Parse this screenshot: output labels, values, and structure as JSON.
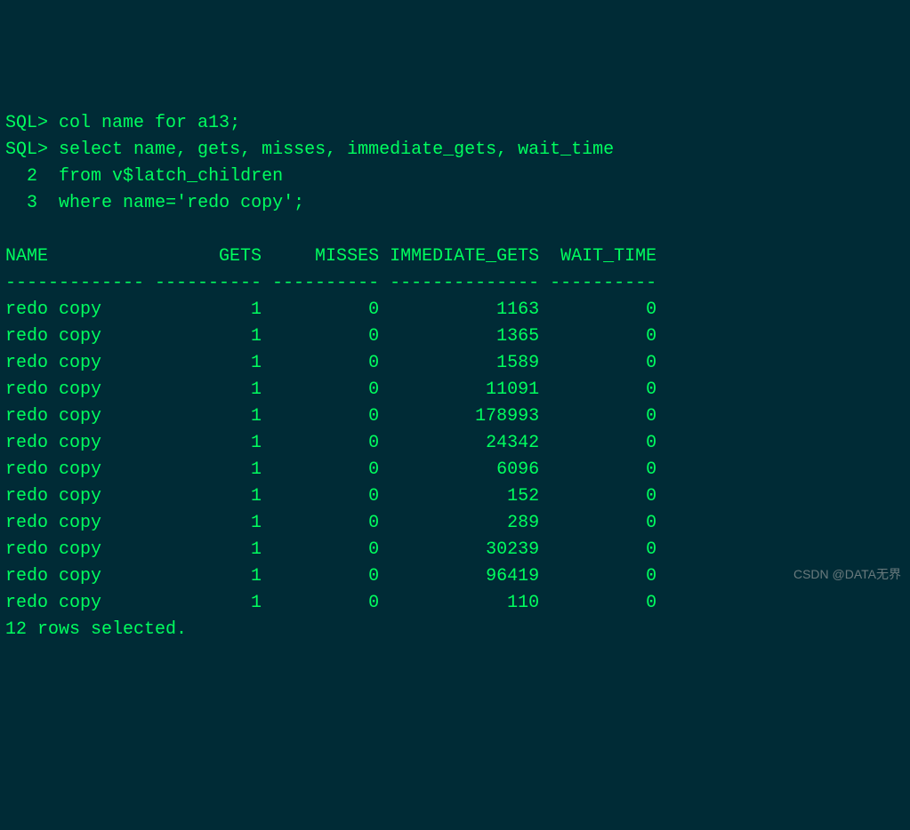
{
  "prompt": "SQL>",
  "commands": [
    "col name for a13;",
    "select name, gets, misses, immediate_gets, wait_time"
  ],
  "continuation": [
    {
      "num": "2",
      "text": "from v$latch_children"
    },
    {
      "num": "3",
      "text": "where name='redo copy';"
    }
  ],
  "headers": {
    "name": "NAME",
    "gets": "GETS",
    "misses": "MISSES",
    "immediate_gets": "IMMEDIATE_GETS",
    "wait_time": "WAIT_TIME"
  },
  "separator": {
    "name": "-------------",
    "gets": "----------",
    "misses": "----------",
    "immediate_gets": "--------------",
    "wait_time": "----------"
  },
  "rows": [
    {
      "name": "redo copy",
      "gets": "1",
      "misses": "0",
      "immediate_gets": "1163",
      "wait_time": "0"
    },
    {
      "name": "redo copy",
      "gets": "1",
      "misses": "0",
      "immediate_gets": "1365",
      "wait_time": "0"
    },
    {
      "name": "redo copy",
      "gets": "1",
      "misses": "0",
      "immediate_gets": "1589",
      "wait_time": "0"
    },
    {
      "name": "redo copy",
      "gets": "1",
      "misses": "0",
      "immediate_gets": "11091",
      "wait_time": "0"
    },
    {
      "name": "redo copy",
      "gets": "1",
      "misses": "0",
      "immediate_gets": "178993",
      "wait_time": "0"
    },
    {
      "name": "redo copy",
      "gets": "1",
      "misses": "0",
      "immediate_gets": "24342",
      "wait_time": "0"
    },
    {
      "name": "redo copy",
      "gets": "1",
      "misses": "0",
      "immediate_gets": "6096",
      "wait_time": "0"
    },
    {
      "name": "redo copy",
      "gets": "1",
      "misses": "0",
      "immediate_gets": "152",
      "wait_time": "0"
    },
    {
      "name": "redo copy",
      "gets": "1",
      "misses": "0",
      "immediate_gets": "289",
      "wait_time": "0"
    },
    {
      "name": "redo copy",
      "gets": "1",
      "misses": "0",
      "immediate_gets": "30239",
      "wait_time": "0"
    },
    {
      "name": "redo copy",
      "gets": "1",
      "misses": "0",
      "immediate_gets": "96419",
      "wait_time": "0"
    },
    {
      "name": "redo copy",
      "gets": "1",
      "misses": "0",
      "immediate_gets": "110",
      "wait_time": "0"
    }
  ],
  "footer": "12 rows selected.",
  "watermark": "CSDN @DATA无界"
}
